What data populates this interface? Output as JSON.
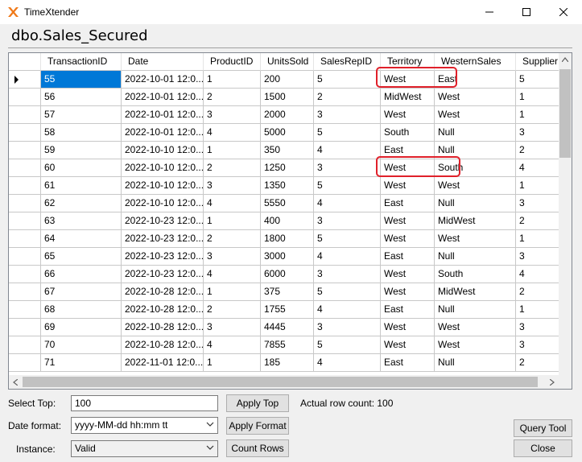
{
  "window": {
    "app_title": "TimeXtender",
    "controls": {
      "minimize_icon": "minimize-icon",
      "maximize_icon": "maximize-icon",
      "close_icon": "close-icon"
    }
  },
  "heading": "dbo.Sales_Secured",
  "grid": {
    "columns": [
      "TransactionID",
      "Date",
      "ProductID",
      "UnitsSold",
      "SalesRepID",
      "Territory",
      "WesternSales",
      "SupplierID"
    ],
    "rows": [
      [
        "55",
        "2022-10-01 12:0...",
        "1",
        "200",
        "5",
        "West",
        "East",
        "5"
      ],
      [
        "56",
        "2022-10-01 12:0...",
        "2",
        "1500",
        "2",
        "MidWest",
        "West",
        "1"
      ],
      [
        "57",
        "2022-10-01 12:0...",
        "3",
        "2000",
        "3",
        "West",
        "West",
        "1"
      ],
      [
        "58",
        "2022-10-01 12:0...",
        "4",
        "5000",
        "5",
        "South",
        "Null",
        "3"
      ],
      [
        "59",
        "2022-10-10 12:0...",
        "1",
        "350",
        "4",
        "East",
        "Null",
        "2"
      ],
      [
        "60",
        "2022-10-10 12:0...",
        "2",
        "1250",
        "3",
        "West",
        "South",
        "4"
      ],
      [
        "61",
        "2022-10-10 12:0...",
        "3",
        "1350",
        "5",
        "West",
        "West",
        "1"
      ],
      [
        "62",
        "2022-10-10 12:0...",
        "4",
        "5550",
        "4",
        "East",
        "Null",
        "3"
      ],
      [
        "63",
        "2022-10-23 12:0...",
        "1",
        "400",
        "3",
        "West",
        "MidWest",
        "2"
      ],
      [
        "64",
        "2022-10-23 12:0...",
        "2",
        "1800",
        "5",
        "West",
        "West",
        "1"
      ],
      [
        "65",
        "2022-10-23 12:0...",
        "3",
        "3000",
        "4",
        "East",
        "Null",
        "3"
      ],
      [
        "66",
        "2022-10-23 12:0...",
        "4",
        "6000",
        "3",
        "West",
        "South",
        "4"
      ],
      [
        "67",
        "2022-10-28 12:0...",
        "1",
        "375",
        "5",
        "West",
        "MidWest",
        "2"
      ],
      [
        "68",
        "2022-10-28 12:0...",
        "2",
        "1755",
        "4",
        "East",
        "Null",
        "1"
      ],
      [
        "69",
        "2022-10-28 12:0...",
        "3",
        "4445",
        "3",
        "West",
        "West",
        "3"
      ],
      [
        "70",
        "2022-10-28 12:0...",
        "4",
        "7855",
        "5",
        "West",
        "West",
        "3"
      ],
      [
        "71",
        "2022-11-01 12:0...",
        "1",
        "185",
        "4",
        "East",
        "Null",
        "2"
      ]
    ],
    "selected_row": 0,
    "highlight_color": "#e0202a",
    "selection_color": "#0078d7"
  },
  "controls": {
    "select_top_label": "Select Top:",
    "select_top_value": "100",
    "apply_top_label": "Apply Top",
    "row_count_text": "Actual row count: 100",
    "date_format_label": "Date format:",
    "date_format_value": "yyyy-MM-dd hh:mm tt",
    "apply_format_label": "Apply Format",
    "instance_label": "Instance:",
    "instance_value": "Valid",
    "count_rows_label": "Count Rows",
    "query_tool_label": "Query Tool",
    "close_label": "Close"
  }
}
